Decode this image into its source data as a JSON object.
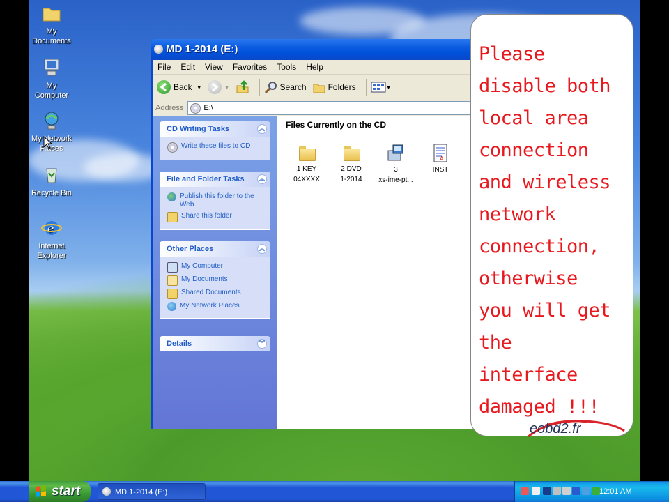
{
  "desktop": {
    "icons": [
      {
        "label_1": "My",
        "label_2": "Documents"
      },
      {
        "label_1": "My",
        "label_2": "Computer"
      },
      {
        "label_1": "My Network",
        "label_2": "Places"
      },
      {
        "label_1": "Recycle Bin",
        "label_2": ""
      },
      {
        "label_1": "Internet",
        "label_2": "Explorer"
      }
    ]
  },
  "window": {
    "title": "MD 1-2014 (E:)",
    "menu": [
      "File",
      "Edit",
      "View",
      "Favorites",
      "Tools",
      "Help"
    ],
    "toolbar": {
      "back": "Back",
      "search": "Search",
      "folders": "Folders"
    },
    "address": {
      "label": "Address",
      "value": "E:\\"
    },
    "tasks": {
      "cd_writing": {
        "title": "CD Writing Tasks",
        "items": [
          "Write these files to CD"
        ]
      },
      "file_folder": {
        "title": "File and Folder Tasks",
        "items": [
          "Publish this folder to the Web",
          "Share this folder"
        ]
      },
      "other_places": {
        "title": "Other Places",
        "items": [
          "My Computer",
          "My Documents",
          "Shared Documents",
          "My Network Places"
        ]
      },
      "details": {
        "title": "Details"
      }
    },
    "files_header": "Files Currently on the CD",
    "files": [
      {
        "line1": "1     KEY",
        "line2": "04XXXX"
      },
      {
        "line1": "2     DVD",
        "line2": "1-2014"
      },
      {
        "line1": "3",
        "line2": "xs-ime-pt..."
      },
      {
        "line1": "INST",
        "line2": ""
      }
    ]
  },
  "notice": {
    "lines": [
      "Please",
      "disable both",
      "local area",
      "connection",
      "and wireless",
      "network",
      "connection,",
      "otherwise",
      "you will get",
      "the",
      "interface",
      "damaged !!!"
    ],
    "color": "#e8191e",
    "brand": "eobd2.fr"
  },
  "taskbar": {
    "start": "start",
    "active_window": "MD 1-2014 (E:)",
    "clock": "12:01 AM"
  }
}
